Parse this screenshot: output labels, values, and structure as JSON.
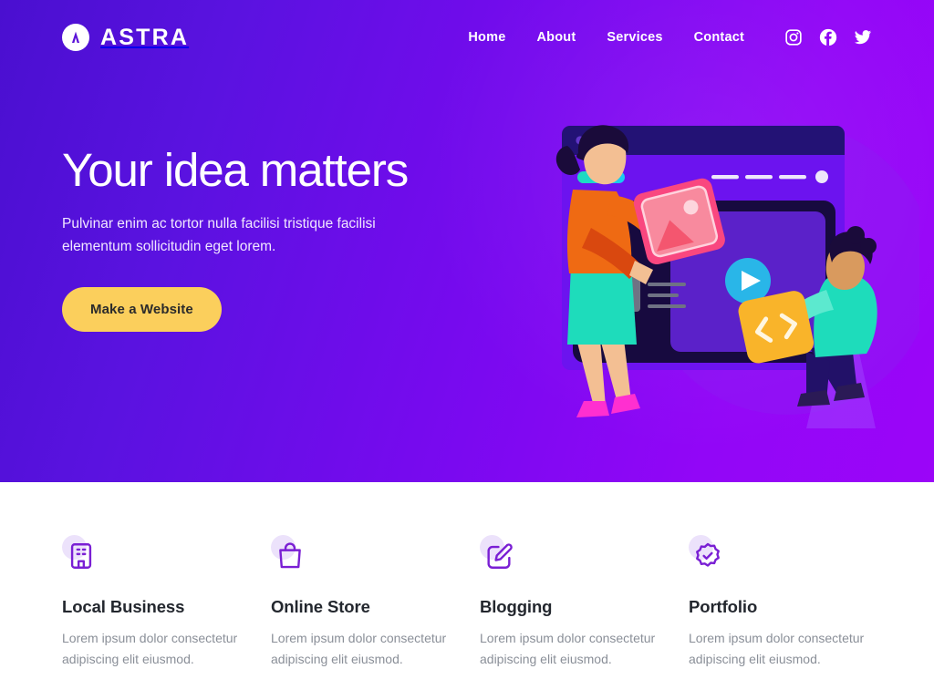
{
  "theme": {
    "gradient_start": "#4a0fd0",
    "gradient_end": "#9b05f8",
    "cta_bg": "#fbcf5c",
    "cta_text": "#2b2b2b",
    "icon_purple": "#7a1fd4",
    "icon_blob": "#ece2fb",
    "heading_dark": "#23272e",
    "body_gray": "#8a8f98"
  },
  "header": {
    "brand": {
      "name": "ASTRA",
      "logo_icon": "astra-logo-icon"
    },
    "nav_links": [
      {
        "label": "Home"
      },
      {
        "label": "About"
      },
      {
        "label": "Services"
      },
      {
        "label": "Contact"
      }
    ],
    "social": [
      {
        "name": "instagram-icon"
      },
      {
        "name": "facebook-icon"
      },
      {
        "name": "twitter-icon"
      }
    ]
  },
  "hero": {
    "title": "Your idea matters",
    "subtitle": "Pulvinar enim ac tortor nulla facilisi tristique facilisi elementum sollicitudin eget lorem.",
    "cta_label": "Make a Website",
    "illustration": {
      "name": "website-builder-illustration",
      "elements": [
        "browser-window-mockup",
        "video-play-button",
        "woman-holding-image-card",
        "man-holding-code-card"
      ]
    }
  },
  "features": [
    {
      "icon": "building-icon",
      "title": "Local Business",
      "description": "Lorem ipsum dolor consectetur adipiscing elit eiusmod."
    },
    {
      "icon": "shopping-bag-icon",
      "title": "Online Store",
      "description": "Lorem ipsum dolor consectetur adipiscing elit eiusmod."
    },
    {
      "icon": "edit-square-icon",
      "title": "Blogging",
      "description": "Lorem ipsum dolor consectetur adipiscing elit eiusmod."
    },
    {
      "icon": "verified-badge-icon",
      "title": "Portfolio",
      "description": "Lorem ipsum dolor consectetur adipiscing elit eiusmod."
    }
  ]
}
